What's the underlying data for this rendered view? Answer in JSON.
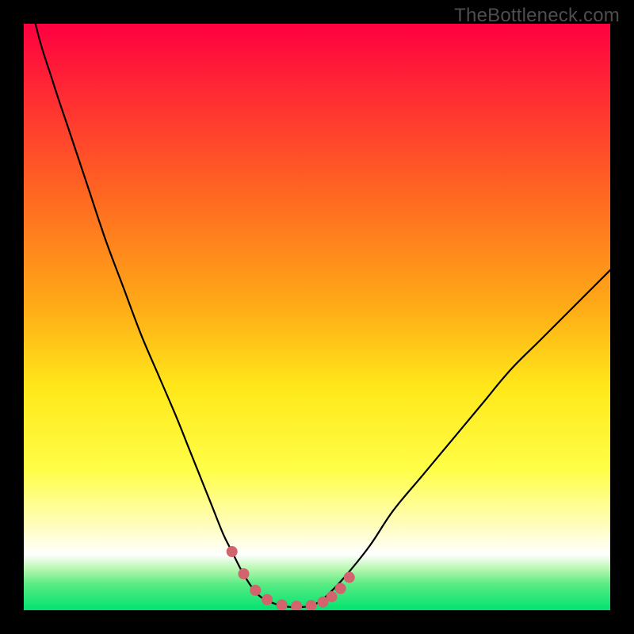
{
  "watermark": "TheBottleneck.com",
  "chart_data": {
    "type": "line",
    "title": "",
    "xlabel": "",
    "ylabel": "",
    "xlim": [
      0,
      100
    ],
    "ylim": [
      0,
      100
    ],
    "grid": false,
    "legend": false,
    "gradient_stops": [
      {
        "offset": 0,
        "color": "#ff0040"
      },
      {
        "offset": 0.12,
        "color": "#ff2b33"
      },
      {
        "offset": 0.3,
        "color": "#ff6a21"
      },
      {
        "offset": 0.48,
        "color": "#ffaa17"
      },
      {
        "offset": 0.62,
        "color": "#ffe81a"
      },
      {
        "offset": 0.76,
        "color": "#fffe47"
      },
      {
        "offset": 0.86,
        "color": "#fffdc2"
      },
      {
        "offset": 0.905,
        "color": "#ffffff"
      },
      {
        "offset": 0.93,
        "color": "#b6f7af"
      },
      {
        "offset": 0.955,
        "color": "#5beb84"
      },
      {
        "offset": 1.0,
        "color": "#00e36f"
      }
    ],
    "series": [
      {
        "name": "bottleneck-curve",
        "stroke": "#000000",
        "stroke_width": 2.2,
        "x": [
          0,
          2,
          5,
          8,
          11,
          14,
          17,
          20,
          23,
          26,
          28,
          30,
          32,
          34,
          35.5,
          37,
          38.5,
          40,
          42,
          45,
          48,
          50,
          52,
          55,
          59,
          63,
          68,
          73,
          78,
          83,
          88,
          93,
          98,
          100
        ],
        "y": [
          112,
          100,
          90,
          81,
          72,
          63,
          55,
          47,
          40,
          33,
          28,
          23,
          18,
          13,
          10,
          7,
          4.5,
          2.6,
          1.4,
          0.6,
          0.6,
          1.2,
          2.8,
          6,
          11,
          17,
          23,
          29,
          35,
          41,
          46,
          51,
          56,
          58
        ]
      }
    ],
    "markers": {
      "name": "highlight-dots",
      "color": "#d1646c",
      "radius": 7,
      "x": [
        35.5,
        37.5,
        39.5,
        41.5,
        44,
        46.5,
        49,
        51,
        52.5,
        54,
        55.5
      ],
      "y": [
        10,
        6.2,
        3.4,
        1.8,
        0.9,
        0.7,
        0.8,
        1.4,
        2.3,
        3.7,
        5.6
      ]
    }
  }
}
